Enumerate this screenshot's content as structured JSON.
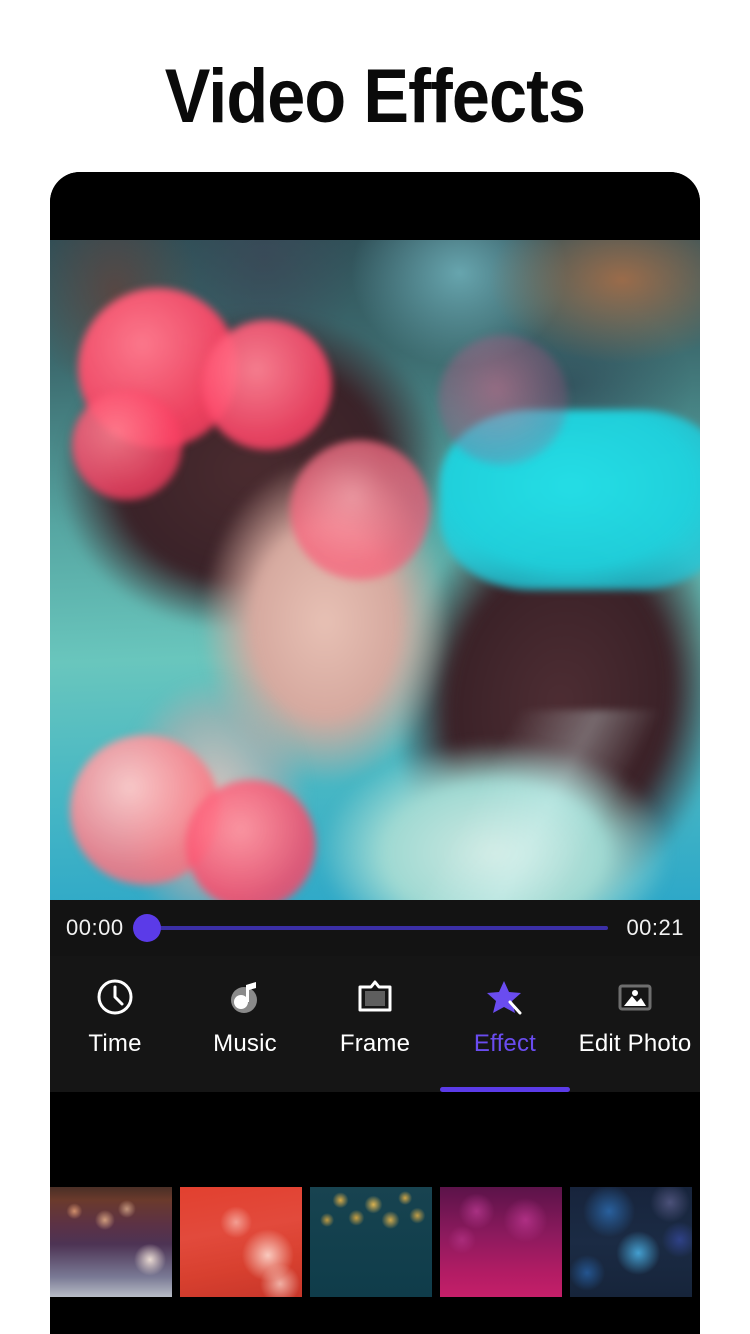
{
  "page": {
    "title": "Video Effects",
    "background_color": "#ffffff"
  },
  "theme": {
    "accent": "#5b3be8",
    "accent_text": "#6a4cf0",
    "panel_bg": "#151515",
    "timeline_bg": "#131313",
    "panel_black": "#000000",
    "label_color": "#ffffff"
  },
  "phone": {
    "preview": {
      "name": "video-preview",
      "description": "Woman leaning on her hand, teal and cyan lighting, pink bokeh light effect overlay"
    },
    "timeline": {
      "start_time": "00:00",
      "end_time": "00:21",
      "progress_percent": 0
    },
    "tabs": [
      {
        "label": "Time",
        "icon": "clock-icon",
        "active": false
      },
      {
        "label": "Music",
        "icon": "music-note-icon",
        "active": false
      },
      {
        "label": "Frame",
        "icon": "frame-icon",
        "active": false
      },
      {
        "label": "Effect",
        "icon": "magic-wand-icon",
        "active": true
      },
      {
        "label": "Edit Photo",
        "icon": "image-icon",
        "active": false
      }
    ],
    "effects": [
      {
        "name": "sparkle-purple-effect"
      },
      {
        "name": "red-hearts-effect"
      },
      {
        "name": "gold-bokeh-teal-effect"
      },
      {
        "name": "magenta-bokeh-effect"
      },
      {
        "name": "blue-bokeh-effect"
      }
    ]
  }
}
